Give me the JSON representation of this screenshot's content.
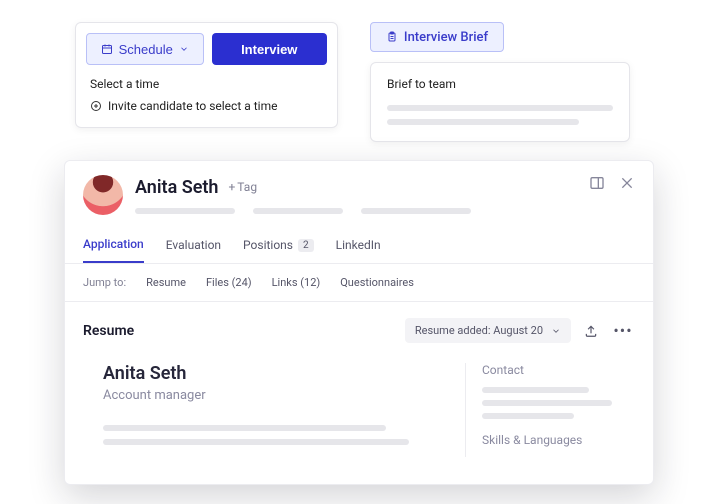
{
  "schedule": {
    "schedule_label": "Schedule",
    "interview_label": "Interview",
    "option_select_time": "Select a time",
    "option_invite_candidate": "Invite candidate to select a time"
  },
  "brief": {
    "button_label": "Interview Brief",
    "card_title": "Brief to team"
  },
  "candidate": {
    "name": "Anita Seth",
    "tag_label": "Tag"
  },
  "tabs": {
    "application": "Application",
    "evaluation": "Evaluation",
    "positions_label": "Positions",
    "positions_count": "2",
    "linkedin": "LinkedIn"
  },
  "jumpto": {
    "label": "Jump to:",
    "resume": "Resume",
    "files": "Files (24)",
    "links": "Links (12)",
    "questionnaires": "Questionnaires"
  },
  "resume": {
    "section_title": "Resume",
    "dropdown_label": "Resume added: August 20",
    "name": "Anita Seth",
    "role": "Account manager",
    "contact_heading": "Contact",
    "skills_heading": "Skills & Languages"
  }
}
